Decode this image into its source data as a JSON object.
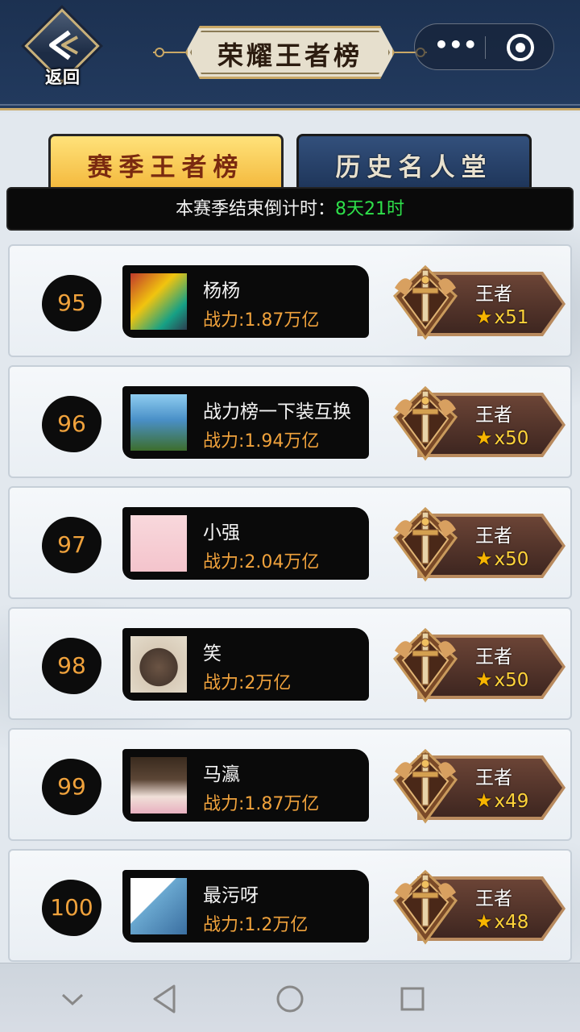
{
  "header": {
    "back_label": "返回",
    "title": "荣耀王者榜",
    "capsule": {
      "more_icon": "more-dots-icon",
      "close_icon": "target-circle-icon"
    }
  },
  "tabs": [
    {
      "label": "赛季王者榜",
      "active": true
    },
    {
      "label": "历史名人堂",
      "active": false
    }
  ],
  "countdown": {
    "label": "本赛季结束倒计时：",
    "value": "8天21时"
  },
  "rows": [
    {
      "rank": "95",
      "name": "杨杨",
      "power": "战力:1.87万亿",
      "tier": "王者",
      "stars": "x51"
    },
    {
      "rank": "96",
      "name": "战力榜一下装互换",
      "power": "战力:1.94万亿",
      "tier": "王者",
      "stars": "x50"
    },
    {
      "rank": "97",
      "name": "小强",
      "power": "战力:2.04万亿",
      "tier": "王者",
      "stars": "x50"
    },
    {
      "rank": "98",
      "name": "笑",
      "power": "战力:2万亿",
      "tier": "王者",
      "stars": "x50"
    },
    {
      "rank": "99",
      "name": "马瀛",
      "power": "战力:1.87万亿",
      "tier": "王者",
      "stars": "x49"
    },
    {
      "rank": "100",
      "name": "最污呀",
      "power": "战力:1.2万亿",
      "tier": "王者",
      "stars": "x48"
    }
  ],
  "colors": {
    "header_bg": "#1c3151",
    "gold": "#c9a866",
    "rank_text": "#f0a23c",
    "countdown_value": "#2ee04a",
    "star": "#f7b500"
  }
}
